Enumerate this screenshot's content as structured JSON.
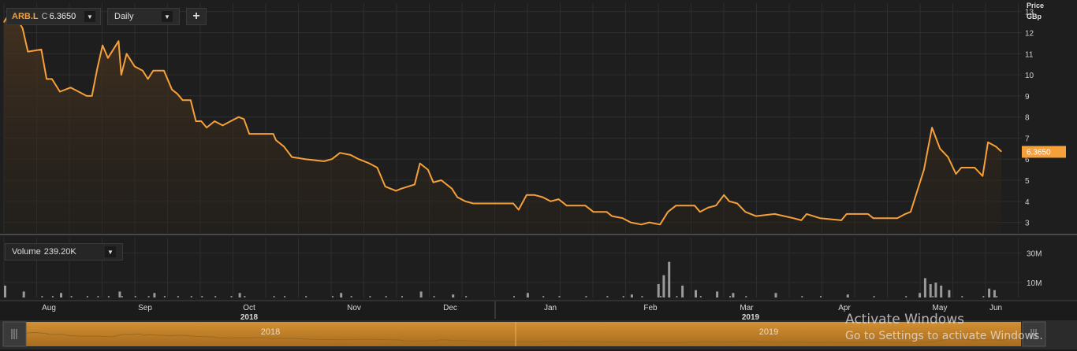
{
  "toolbar": {
    "symbol": "ARB.L",
    "chart_type_label": "C",
    "last_price": "6.3650",
    "symbol_caret_icon": "triangle-down-icon",
    "interval": "Daily",
    "interval_caret_icon": "triangle-down-icon",
    "add_icon": "plus-icon"
  },
  "volume_panel": {
    "label": "Volume",
    "value": "239.20K",
    "caret_icon": "triangle-down-icon"
  },
  "watermark": {
    "line1": "Activate Windows",
    "line2": "Go to Settings to activate Windows."
  },
  "navigator": {
    "year_labels": [
      "2018",
      "2019"
    ],
    "left_handle_icon": "grip-lines-icon",
    "right_handle_icon": "grip-lines-icon"
  },
  "colors": {
    "background": "#1b1b1b",
    "grid": "#2e2e2e",
    "price_line": "#f5a03a",
    "price_fill": "#3a2a1a",
    "volume_bar": "#9a9a9a",
    "navigator": "#c9882c",
    "last_price_tag": "#f5a03a"
  },
  "chart_data": [
    {
      "type": "line",
      "ylabel_line1": "Price",
      "ylabel_line2": "GBp",
      "ylim": [
        2.5,
        13.4
      ],
      "yticks": [
        3,
        4,
        5,
        6,
        7,
        8,
        9,
        10,
        11,
        12,
        13
      ],
      "last_value_label": "6.3650",
      "grid": true,
      "x_month_labels": [
        "Aug",
        "Sep",
        "Oct",
        "Nov",
        "Dec",
        "Jan",
        "Feb",
        "Mar",
        "Apr",
        "May",
        "Jun"
      ],
      "x_year_labels": [
        {
          "label": "2018",
          "under": "Oct"
        },
        {
          "label": "2019",
          "under": "Mar"
        }
      ],
      "x_range": [
        "2018-07-23",
        "2019-06-05"
      ],
      "series": [
        {
          "points": [
            [
              "2018-07-23",
              12.5
            ],
            [
              "2018-07-26",
              13.1
            ],
            [
              "2018-07-30",
              12.2
            ],
            [
              "2018-08-01",
              11.1
            ],
            [
              "2018-08-06",
              11.2
            ],
            [
              "2018-08-08",
              9.8
            ],
            [
              "2018-08-10",
              9.8
            ],
            [
              "2018-08-13",
              9.2
            ],
            [
              "2018-08-17",
              9.4
            ],
            [
              "2018-08-20",
              9.2
            ],
            [
              "2018-08-23",
              9.0
            ],
            [
              "2018-08-25",
              9.0
            ],
            [
              "2018-08-27",
              10.3
            ],
            [
              "2018-08-29",
              11.4
            ],
            [
              "2018-08-31",
              10.8
            ],
            [
              "2018-09-04",
              11.6
            ],
            [
              "2018-09-05",
              10.0
            ],
            [
              "2018-09-07",
              11.0
            ],
            [
              "2018-09-10",
              10.4
            ],
            [
              "2018-09-13",
              10.2
            ],
            [
              "2018-09-15",
              9.8
            ],
            [
              "2018-09-17",
              10.2
            ],
            [
              "2018-09-21",
              10.2
            ],
            [
              "2018-09-24",
              9.3
            ],
            [
              "2018-09-26",
              9.1
            ],
            [
              "2018-09-28",
              8.8
            ],
            [
              "2018-10-01",
              8.8
            ],
            [
              "2018-10-03",
              7.8
            ],
            [
              "2018-10-05",
              7.8
            ],
            [
              "2018-10-07",
              7.5
            ],
            [
              "2018-10-10",
              7.8
            ],
            [
              "2018-10-13",
              7.6
            ],
            [
              "2018-10-16",
              7.8
            ],
            [
              "2018-10-19",
              8.0
            ],
            [
              "2018-10-21",
              7.9
            ],
            [
              "2018-10-23",
              7.2
            ],
            [
              "2018-11-01",
              7.2
            ],
            [
              "2018-11-02",
              6.9
            ],
            [
              "2018-11-05",
              6.6
            ],
            [
              "2018-11-08",
              6.1
            ],
            [
              "2018-11-13",
              6.0
            ],
            [
              "2018-11-20",
              5.9
            ],
            [
              "2018-11-23",
              6.0
            ],
            [
              "2018-11-26",
              6.3
            ],
            [
              "2018-11-30",
              6.2
            ],
            [
              "2018-12-03",
              6.0
            ],
            [
              "2018-12-07",
              5.8
            ],
            [
              "2018-12-10",
              5.6
            ],
            [
              "2018-12-13",
              4.7
            ],
            [
              "2018-12-17",
              4.5
            ],
            [
              "2018-12-19",
              4.6
            ],
            [
              "2018-12-24",
              4.8
            ],
            [
              "2018-12-26",
              5.8
            ],
            [
              "2018-12-29",
              5.5
            ],
            [
              "2018-12-31",
              4.9
            ],
            [
              "2019-01-03",
              5.0
            ],
            [
              "2019-01-07",
              4.6
            ],
            [
              "2019-01-09",
              4.2
            ],
            [
              "2019-01-12",
              4.0
            ],
            [
              "2019-01-15",
              3.9
            ],
            [
              "2019-01-30",
              3.9
            ],
            [
              "2019-02-01",
              3.6
            ],
            [
              "2019-02-04",
              4.3
            ],
            [
              "2019-02-07",
              4.3
            ],
            [
              "2019-02-10",
              4.2
            ],
            [
              "2019-02-13",
              4.0
            ],
            [
              "2019-02-16",
              4.1
            ],
            [
              "2019-02-19",
              3.8
            ],
            [
              "2019-02-26",
              3.8
            ],
            [
              "2019-03-01",
              3.5
            ],
            [
              "2019-03-06",
              3.5
            ],
            [
              "2019-03-08",
              3.3
            ],
            [
              "2019-03-12",
              3.2
            ],
            [
              "2019-03-15",
              3.0
            ],
            [
              "2019-03-19",
              2.9
            ],
            [
              "2019-03-22",
              3.0
            ],
            [
              "2019-03-26",
              2.9
            ],
            [
              "2019-03-29",
              3.5
            ],
            [
              "2019-04-01",
              3.8
            ],
            [
              "2019-04-08",
              3.8
            ],
            [
              "2019-04-10",
              3.5
            ],
            [
              "2019-04-13",
              3.7
            ],
            [
              "2019-04-16",
              3.8
            ],
            [
              "2019-04-19",
              4.3
            ],
            [
              "2019-04-21",
              4.0
            ],
            [
              "2019-04-24",
              3.9
            ],
            [
              "2019-04-27",
              3.5
            ],
            [
              "2019-05-01",
              3.3
            ],
            [
              "2019-05-08",
              3.4
            ],
            [
              "2019-05-15",
              3.2
            ],
            [
              "2019-05-18",
              3.1
            ],
            [
              "2019-05-20",
              3.4
            ],
            [
              "2019-05-25",
              3.2
            ],
            [
              "2019-06-02",
              3.1
            ],
            [
              "2019-06-04",
              3.4
            ],
            [
              "2019-06-12",
              3.4
            ],
            [
              "2019-06-14",
              3.2
            ],
            [
              "2019-06-23",
              3.2
            ],
            [
              "2019-06-26",
              3.4
            ],
            [
              "2019-06-28",
              3.5
            ],
            [
              "2019-07-01",
              4.7
            ],
            [
              "2019-07-03",
              5.5
            ],
            [
              "2019-07-06",
              7.5
            ],
            [
              "2019-07-09",
              6.5
            ],
            [
              "2019-07-12",
              6.1
            ],
            [
              "2019-07-15",
              5.3
            ],
            [
              "2019-07-17",
              5.6
            ],
            [
              "2019-07-22",
              5.6
            ],
            [
              "2019-07-25",
              5.2
            ],
            [
              "2019-07-27",
              6.8
            ],
            [
              "2019-07-30",
              6.6
            ],
            [
              "2019-08-01",
              6.365
            ]
          ]
        }
      ]
    },
    {
      "type": "bar",
      "ylabel": "Volume",
      "yticks": [
        {
          "value": 10000000,
          "label": "10M"
        },
        {
          "value": 30000000,
          "label": "30M"
        }
      ],
      "ylim": [
        0,
        36000000
      ],
      "note": "volume bars in millions",
      "series": [
        {
          "name": "Volume",
          "points": [
            [
              "2018-07-23",
              8
            ],
            [
              "2018-07-30",
              4
            ],
            [
              "2018-08-13",
              3
            ],
            [
              "2018-09-04",
              4
            ],
            [
              "2018-09-17",
              3
            ],
            [
              "2018-10-19",
              3
            ],
            [
              "2018-11-26",
              3
            ],
            [
              "2018-12-26",
              4
            ],
            [
              "2019-01-07",
              2
            ],
            [
              "2019-02-04",
              3
            ],
            [
              "2019-03-15",
              2
            ],
            [
              "2019-03-25",
              9
            ],
            [
              "2019-03-27",
              15
            ],
            [
              "2019-03-29",
              24
            ],
            [
              "2019-04-03",
              8
            ],
            [
              "2019-04-08",
              5
            ],
            [
              "2019-04-16",
              4
            ],
            [
              "2019-04-22",
              3
            ],
            [
              "2019-05-08",
              3
            ],
            [
              "2019-06-04",
              2
            ],
            [
              "2019-07-01",
              3
            ],
            [
              "2019-07-03",
              13
            ],
            [
              "2019-07-05",
              9
            ],
            [
              "2019-07-07",
              10
            ],
            [
              "2019-07-09",
              8
            ],
            [
              "2019-07-12",
              5
            ],
            [
              "2019-07-27",
              6
            ],
            [
              "2019-07-29",
              5
            ]
          ]
        }
      ]
    }
  ]
}
